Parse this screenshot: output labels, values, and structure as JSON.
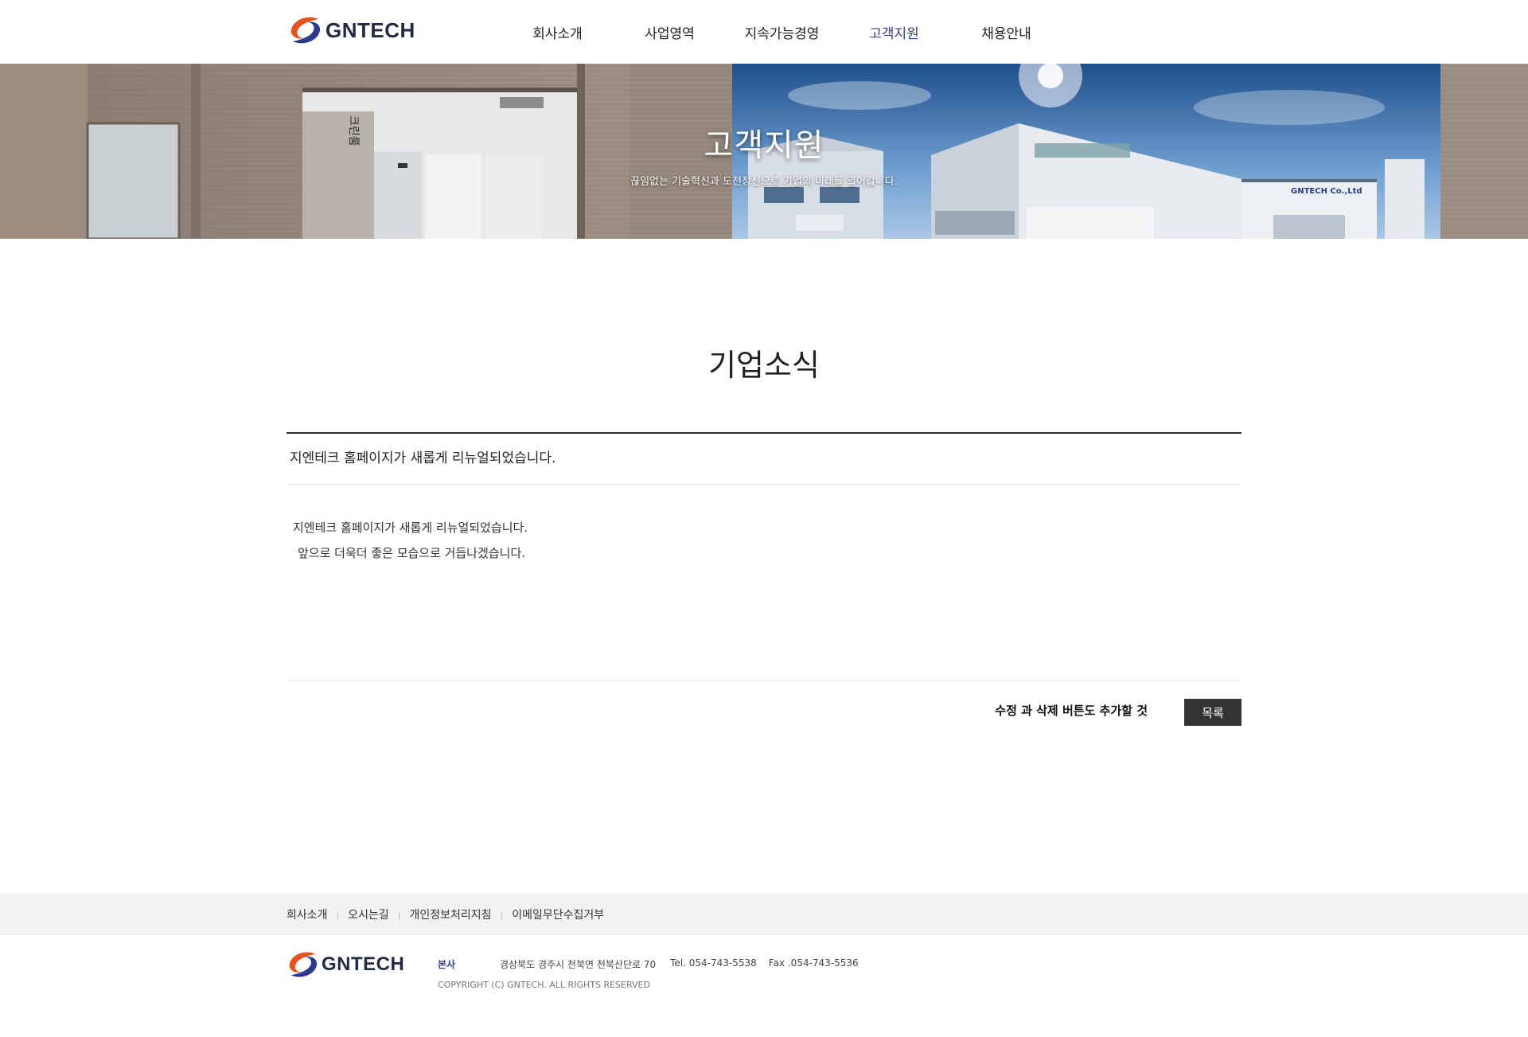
{
  "header": {
    "logo_text": "GNTECH",
    "nav": [
      {
        "label": "회사소개",
        "active": false
      },
      {
        "label": "사업영역",
        "active": false
      },
      {
        "label": "지속가능경영",
        "active": false
      },
      {
        "label": "고객지원",
        "active": true
      },
      {
        "label": "채용안내",
        "active": false
      }
    ]
  },
  "banner": {
    "title": "고객지원",
    "subtitle": "끊임없는 기술혁신과 도전정신으로 기업의 미래를 열어갑니다.",
    "sign_clean_room": "크린룸",
    "sign_building": "GNTECH Co.,Ltd"
  },
  "main": {
    "page_title": "기업소식",
    "post": {
      "subject": "지엔테크 홈페이지가 새롭게 리뉴얼되었습니다.",
      "body_lines": [
        "지엔테크 홈페이지가 새롭게 리뉴얼되었습니다.",
        "앞으로 더욱더 좋은 모습으로 거듭나겠습니다."
      ]
    },
    "note": "수정 과 삭제 버튼도 추가할 것",
    "list_button": "목록"
  },
  "footer": {
    "links": [
      "회사소개",
      "오시는길",
      "개인정보처리지침",
      "이메일무단수집거부"
    ],
    "logo_text": "GNTECH",
    "hq_label": "본사",
    "address": "경상북도 경주시 천북면 천북산단로 70",
    "tel": "Tel. 054-743-5538",
    "fax": "Fax .054-743-5536",
    "copyright": "COPYRIGHT (C) GNTECH. ALL RIGHTS RESERVED"
  },
  "colors": {
    "accent": "#2f3f8f",
    "button_bg": "#333333",
    "footer_bar_bg": "#f2f2f2"
  }
}
